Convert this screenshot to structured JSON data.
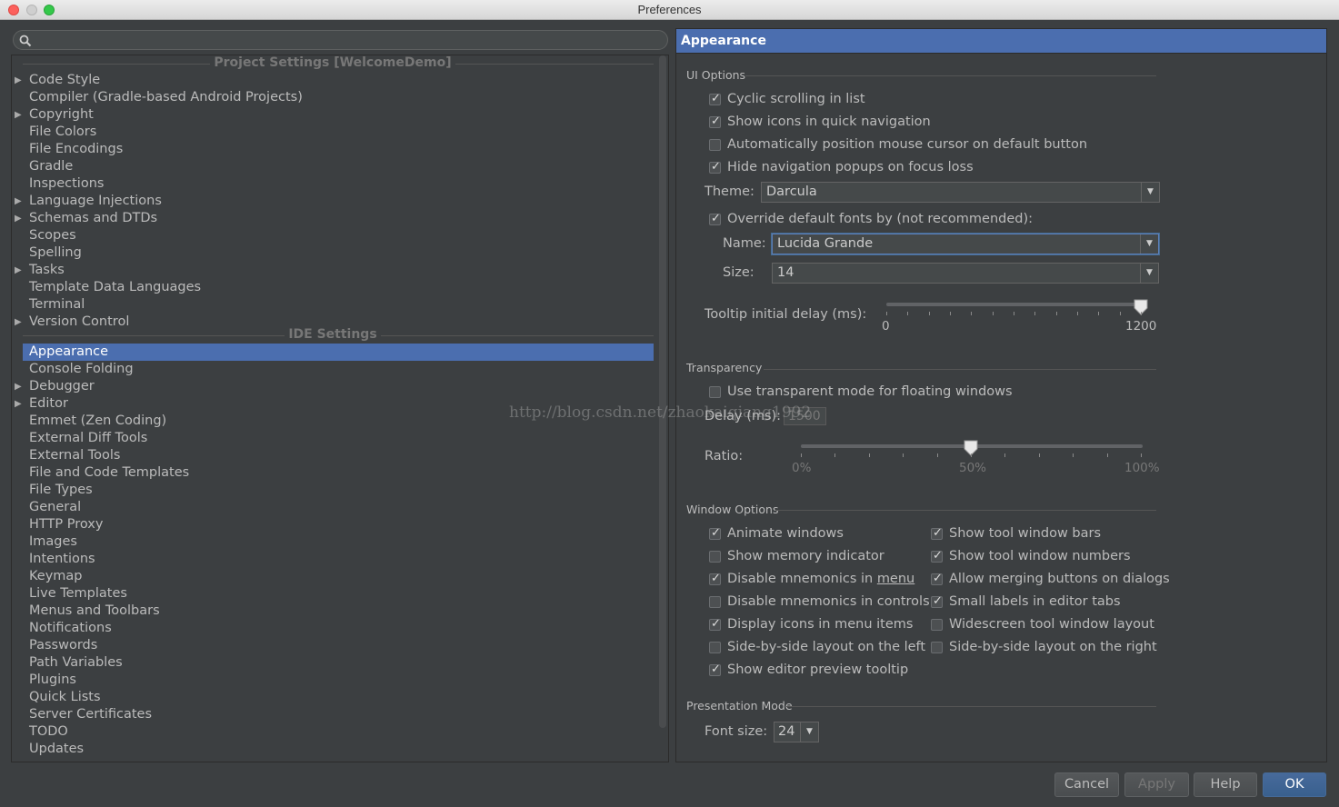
{
  "window": {
    "title": "Preferences"
  },
  "search": {
    "placeholder": ""
  },
  "tree": {
    "project_header": "Project Settings [WelcomeDemo]",
    "project_items": [
      {
        "label": "Code Style",
        "expandable": true
      },
      {
        "label": "Compiler (Gradle-based Android Projects)",
        "expandable": false
      },
      {
        "label": "Copyright",
        "expandable": true
      },
      {
        "label": "File Colors",
        "expandable": false
      },
      {
        "label": "File Encodings",
        "expandable": false
      },
      {
        "label": "Gradle",
        "expandable": false
      },
      {
        "label": "Inspections",
        "expandable": false
      },
      {
        "label": "Language Injections",
        "expandable": true
      },
      {
        "label": "Schemas and DTDs",
        "expandable": true
      },
      {
        "label": "Scopes",
        "expandable": false
      },
      {
        "label": "Spelling",
        "expandable": false
      },
      {
        "label": "Tasks",
        "expandable": true
      },
      {
        "label": "Template Data Languages",
        "expandable": false
      },
      {
        "label": "Terminal",
        "expandable": false
      },
      {
        "label": "Version Control",
        "expandable": true
      }
    ],
    "ide_header": "IDE Settings",
    "ide_items": [
      {
        "label": "Appearance",
        "expandable": false,
        "selected": true
      },
      {
        "label": "Console Folding",
        "expandable": false
      },
      {
        "label": "Debugger",
        "expandable": true
      },
      {
        "label": "Editor",
        "expandable": true
      },
      {
        "label": "Emmet (Zen Coding)",
        "expandable": false
      },
      {
        "label": "External Diff Tools",
        "expandable": false
      },
      {
        "label": "External Tools",
        "expandable": false
      },
      {
        "label": "File and Code Templates",
        "expandable": false
      },
      {
        "label": "File Types",
        "expandable": false
      },
      {
        "label": "General",
        "expandable": false
      },
      {
        "label": "HTTP Proxy",
        "expandable": false
      },
      {
        "label": "Images",
        "expandable": false
      },
      {
        "label": "Intentions",
        "expandable": false
      },
      {
        "label": "Keymap",
        "expandable": false
      },
      {
        "label": "Live Templates",
        "expandable": false
      },
      {
        "label": "Menus and Toolbars",
        "expandable": false
      },
      {
        "label": "Notifications",
        "expandable": false
      },
      {
        "label": "Passwords",
        "expandable": false
      },
      {
        "label": "Path Variables",
        "expandable": false
      },
      {
        "label": "Plugins",
        "expandable": false
      },
      {
        "label": "Quick Lists",
        "expandable": false
      },
      {
        "label": "Server Certificates",
        "expandable": false
      },
      {
        "label": "TODO",
        "expandable": false
      },
      {
        "label": "Updates",
        "expandable": false
      }
    ]
  },
  "panel": {
    "title": "Appearance",
    "ui_options": {
      "title": "UI Options",
      "checkboxes": [
        {
          "label": "Cyclic scrolling in list",
          "checked": true
        },
        {
          "label": "Show icons in quick navigation",
          "checked": true
        },
        {
          "label": "Automatically position mouse cursor on default button",
          "checked": false
        },
        {
          "label": "Hide navigation popups on focus loss",
          "checked": true
        }
      ],
      "theme_label": "Theme:",
      "theme_value": "Darcula",
      "override_fonts": {
        "label": "Override default fonts by (not recommended):",
        "checked": true
      },
      "name_label": "Name:",
      "name_value": "Lucida Grande",
      "size_label": "Size:",
      "size_value": "14",
      "tooltip_label": "Tooltip initial delay (ms):",
      "tooltip_min": "0",
      "tooltip_max": "1200",
      "tooltip_value": 1200
    },
    "transparency": {
      "title": "Transparency",
      "use_transparent": {
        "label": "Use transparent mode for floating windows",
        "checked": false
      },
      "delay_label": "Delay (ms):",
      "delay_value": "1500",
      "ratio_label": "Ratio:",
      "ratio_min": "0%",
      "ratio_mid": "50%",
      "ratio_max": "100%",
      "ratio_value": 0.5
    },
    "window_options": {
      "title": "Window Options",
      "left": [
        {
          "label": "Animate windows",
          "checked": true
        },
        {
          "label": "Show memory indicator",
          "checked": false
        },
        {
          "label": "Disable mnemonics in ",
          "underlined": "menu",
          "checked": true
        },
        {
          "label": "Disable mnemonics in controls",
          "checked": false
        },
        {
          "label": "Display icons in menu items",
          "checked": true
        },
        {
          "label": "Side-by-side layout on the left",
          "checked": false
        },
        {
          "label": "Show editor preview tooltip",
          "checked": true
        }
      ],
      "right": [
        {
          "label": "Show tool window bars",
          "checked": true
        },
        {
          "label": "Show tool window numbers",
          "checked": true
        },
        {
          "label": "Allow merging buttons on dialogs",
          "checked": true
        },
        {
          "label": "Small labels in editor tabs",
          "checked": true
        },
        {
          "label": "Widescreen tool window layout",
          "checked": false
        },
        {
          "label": "Side-by-side layout on the right",
          "checked": false
        }
      ]
    },
    "presentation": {
      "title": "Presentation Mode",
      "font_size_label": "Font size:",
      "font_size_value": "24"
    }
  },
  "buttons": {
    "cancel": "Cancel",
    "apply": "Apply",
    "help": "Help",
    "ok": "OK"
  },
  "watermark": "http://blog.csdn.net/zhaokaiqiang1992",
  "colors": {
    "selection": "#4b6eaf",
    "background": "#3c3f41",
    "primary_button": "#39608e"
  }
}
